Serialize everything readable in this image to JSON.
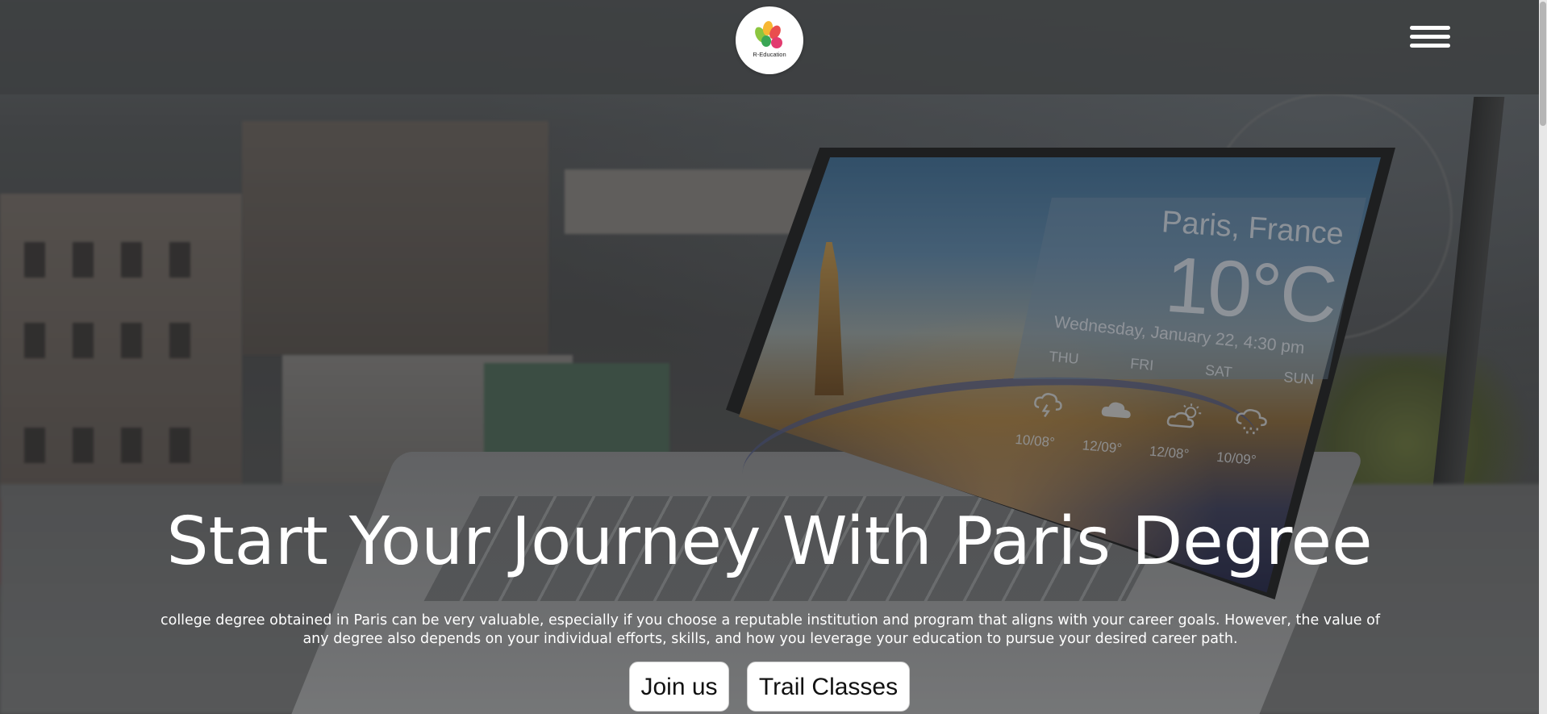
{
  "header": {
    "logo_text": "R-Education",
    "logo_icon": "r-education-logo",
    "menu_icon": "hamburger-menu-icon"
  },
  "hero": {
    "title": "Start Your Journey With Paris Degree",
    "description": "college degree obtained in Paris can be very valuable, especially if you choose a reputable institution and program that aligns with your career goals. However, the value of any degree also depends on your individual efforts, skills, and how you leverage your education to pursue your desired career path.",
    "buttons": {
      "join": "Join us",
      "trial": "Trail Classes"
    }
  },
  "background_screen": {
    "city": "Paris, France",
    "temperature": "10°C",
    "datetime": "Wednesday, January 22, 4:30 pm",
    "days": [
      "THU",
      "FRI",
      "SAT",
      "SUN"
    ],
    "temps": [
      "10/08°",
      "12/09°",
      "12/08°",
      "10/09°"
    ]
  },
  "colors": {
    "header_bg": "#3c3e40",
    "overlay": "#232323",
    "button_bg": "#ffffff",
    "text": "#ffffff"
  }
}
